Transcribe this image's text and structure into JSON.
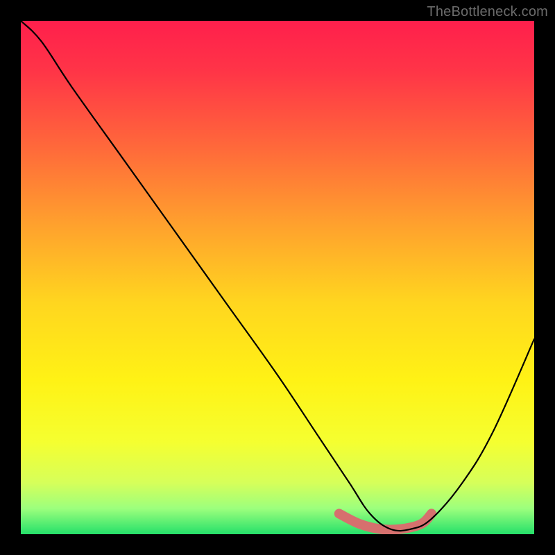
{
  "watermark": "TheBottleneck.com",
  "gradient": {
    "stops": [
      {
        "offset": 0.0,
        "color": "#ff1f4c"
      },
      {
        "offset": 0.1,
        "color": "#ff3547"
      },
      {
        "offset": 0.25,
        "color": "#ff6a3a"
      },
      {
        "offset": 0.4,
        "color": "#ffa22d"
      },
      {
        "offset": 0.55,
        "color": "#ffd61f"
      },
      {
        "offset": 0.7,
        "color": "#fff215"
      },
      {
        "offset": 0.82,
        "color": "#f5ff30"
      },
      {
        "offset": 0.9,
        "color": "#d6ff5a"
      },
      {
        "offset": 0.95,
        "color": "#9cff7d"
      },
      {
        "offset": 1.0,
        "color": "#25e06a"
      }
    ]
  },
  "chart_data": {
    "type": "line",
    "title": "",
    "xlabel": "",
    "ylabel": "",
    "xlim": [
      0,
      100
    ],
    "ylim": [
      0,
      100
    ],
    "series": [
      {
        "name": "bottleneck-curve",
        "x": [
          0,
          4,
          10,
          20,
          30,
          40,
          50,
          58,
          64,
          68,
          72,
          76,
          80,
          86,
          92,
          100
        ],
        "values": [
          100,
          96,
          87,
          73,
          59,
          45,
          31,
          19,
          10,
          4,
          1,
          1,
          3,
          10,
          20,
          38
        ]
      }
    ],
    "annotations": [
      {
        "name": "optimal-band",
        "x": [
          62,
          66,
          70,
          74,
          78,
          80
        ],
        "values": [
          4,
          2,
          1,
          1,
          2,
          4
        ]
      }
    ]
  }
}
